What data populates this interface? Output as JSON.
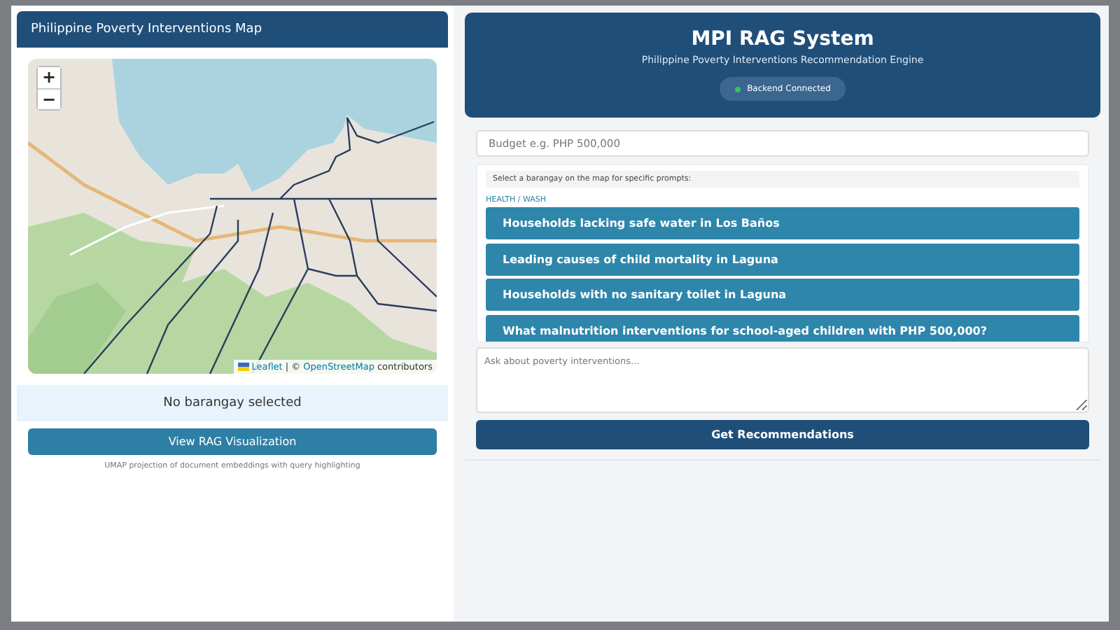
{
  "map_panel": {
    "title": "Philippine Poverty Interventions Map",
    "zoom_controls": [
      "+",
      "−"
    ],
    "attribution": {
      "leaflet": "Leaflet",
      "separator": "| ©",
      "osm": "OpenStreetMap",
      "suffix": "contributors"
    },
    "selection_status": "No barangay selected",
    "visualization_button": "View RAG Visualization",
    "visualization_caption": "UMAP projection of document embeddings with query highlighting"
  },
  "header": {
    "title": "MPI RAG System",
    "subtitle": "Philippine Poverty Interventions Recommendation Engine",
    "status": {
      "label": "Backend Connected",
      "connected": true
    }
  },
  "budget_field": {
    "placeholder": "Budget e.g. PHP 500,000"
  },
  "prompts": {
    "hint": "Select a barangay on the map for specific prompts:",
    "category": "HEALTH / WASH",
    "items": [
      "Households lacking safe water in Los Baños",
      "Leading causes of child mortality in Laguna",
      "Households with no sanitary toilet in Laguna",
      "What malnutrition interventions for school-aged children with PHP 500,000?"
    ]
  },
  "query_field": {
    "placeholder": "Ask about poverty interventions..."
  },
  "submit_button": "Get Recommendations"
}
